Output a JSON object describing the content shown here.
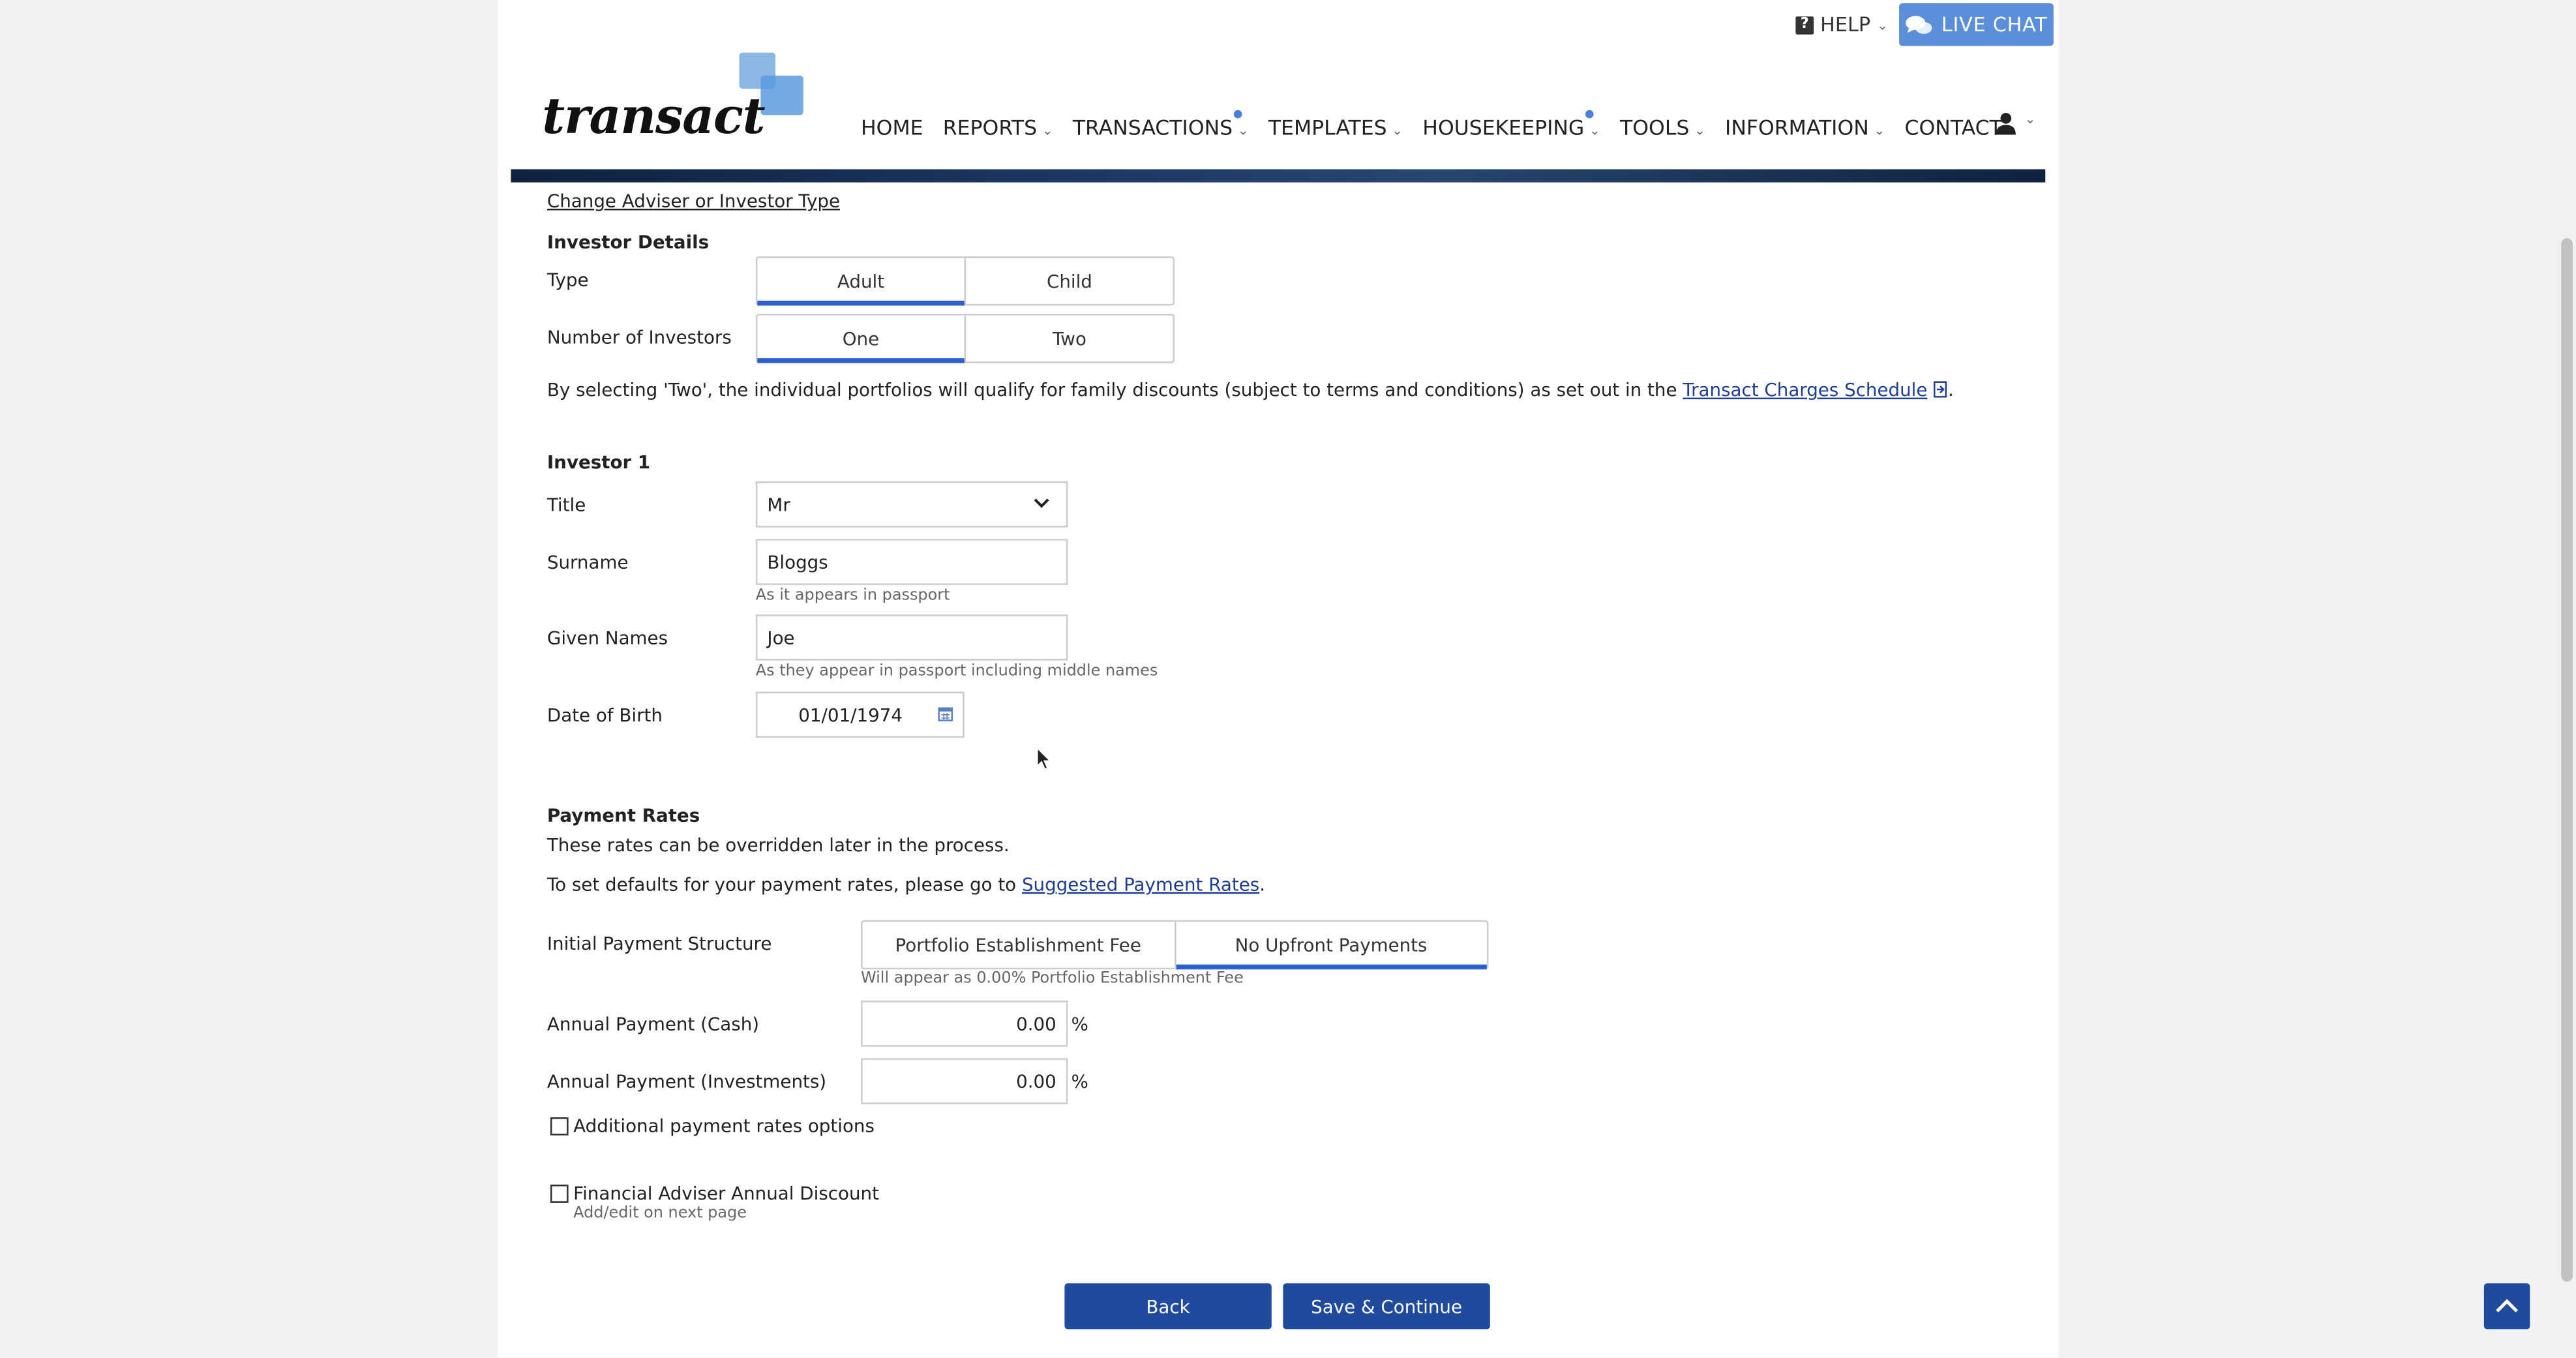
{
  "header": {
    "help_label": "HELP",
    "live_chat_label": "LIVE CHAT",
    "logo_text": "transact"
  },
  "nav": {
    "items": [
      {
        "label": "HOME",
        "has_menu": false
      },
      {
        "label": "REPORTS",
        "has_menu": true
      },
      {
        "label": "TRANSACTIONS",
        "has_menu": true,
        "notification_dot": true
      },
      {
        "label": "TEMPLATES",
        "has_menu": true
      },
      {
        "label": "HOUSEKEEPING",
        "has_menu": true,
        "notification_dot": true
      },
      {
        "label": "TOOLS",
        "has_menu": true
      },
      {
        "label": "INFORMATION",
        "has_menu": true
      },
      {
        "label": "CONTACT",
        "has_menu": true
      }
    ]
  },
  "content": {
    "change_link": "Change Adviser or Investor Type",
    "investor_details_heading": "Investor Details",
    "type_label": "Type",
    "type_options": [
      "Adult",
      "Child"
    ],
    "type_selected": "Adult",
    "num_investors_label": "Number of Investors",
    "num_options": [
      "One",
      "Two"
    ],
    "num_selected": "One",
    "discount_text": "By selecting 'Two', the individual portfolios will qualify for family discounts (subject to terms and conditions) as set out in the",
    "charges_link": "Transact Charges Schedule",
    "investor1_heading": "Investor 1",
    "title_label": "Title",
    "title_value": "Mr",
    "surname_label": "Surname",
    "surname_value": "Bloggs",
    "surname_hint": "As it appears in passport",
    "given_label": "Given Names",
    "given_value": "Joe",
    "given_hint": "As they appear in passport including middle names",
    "dob_label": "Date of Birth",
    "dob_value": "01/01/1974",
    "payment_heading": "Payment Rates",
    "payment_note": "These rates can be overridden later in the process.",
    "defaults_text": "To set defaults for your payment rates, please go to",
    "defaults_link": "Suggested Payment Rates",
    "initial_label": "Initial Payment Structure",
    "initial_options": [
      "Portfolio Establishment Fee",
      "No Upfront Payments"
    ],
    "initial_selected": "No Upfront Payments",
    "initial_hint": "Will appear as 0.00% Portfolio Establishment Fee",
    "annual_cash_label": "Annual Payment (Cash)",
    "annual_cash_value": "0.00",
    "annual_inv_label": "Annual Payment (Investments)",
    "annual_inv_value": "0.00",
    "percent_sign": "%",
    "additional_options_label": "Additional payment rates options",
    "fa_discount_label": "Financial Adviser Annual Discount",
    "fa_discount_hint": "Add/edit on next page"
  },
  "buttons": {
    "back": "Back",
    "save_continue": "Save & Continue"
  },
  "colors": {
    "primary_button": "#1f4a9e",
    "live_chat": "#5b8fd9",
    "selected_underline": "#2d5fd0",
    "link": "#1f3e8f"
  }
}
